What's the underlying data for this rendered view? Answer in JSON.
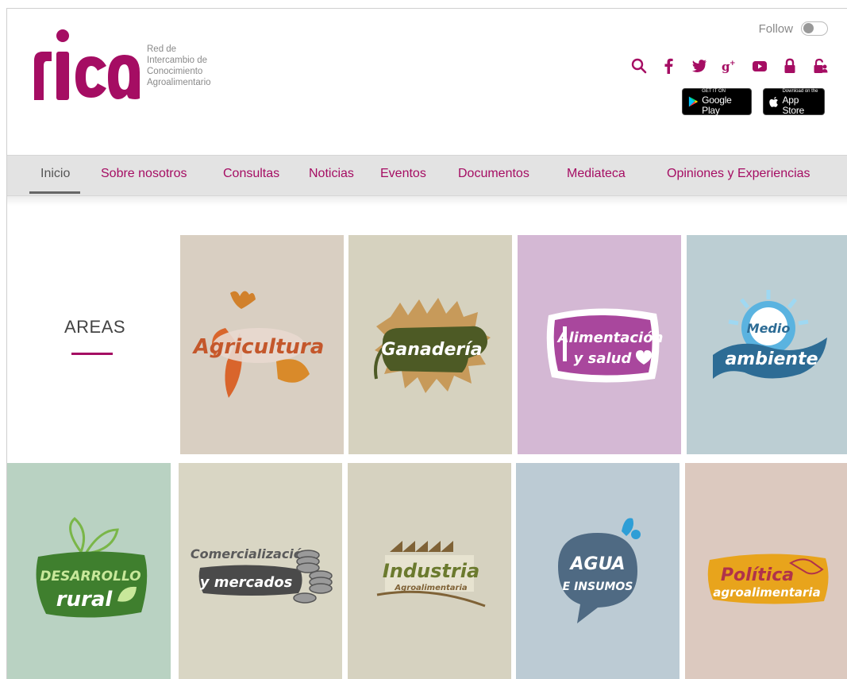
{
  "brand": {
    "logo_text": "rica",
    "tagline": [
      "Red de",
      "Intercambio de",
      "Conocimiento",
      "Agroalimentario"
    ],
    "accent_color": "#a50d63"
  },
  "header": {
    "follow_label": "Follow",
    "follow_enabled": false,
    "social_icons": [
      "search-icon",
      "facebook-icon",
      "twitter-icon",
      "google-plus-icon",
      "youtube-icon",
      "lock-icon",
      "user-lock-icon"
    ],
    "stores": {
      "google_play": {
        "small": "GET IT ON",
        "big": "Google Play"
      },
      "app_store": {
        "small": "Download on the",
        "big": "App Store"
      }
    }
  },
  "nav": {
    "items": [
      {
        "label": "Inicio",
        "active": true
      },
      {
        "label": "Sobre nosotros"
      },
      {
        "label": "Consultas"
      },
      {
        "label": "Noticias"
      },
      {
        "label": "Eventos"
      },
      {
        "label": "Documentos"
      },
      {
        "label": "Mediateca"
      },
      {
        "label": "Opiniones y Experiencias"
      }
    ]
  },
  "areas": {
    "title": "AREAS",
    "tiles": [
      {
        "line1": "Agricultura",
        "bg": "#d9cfc2"
      },
      {
        "line1": "Ganadería",
        "bg": "#d6d2bf"
      },
      {
        "line1": "Alimentación",
        "line2": "y salud",
        "bg": "#d4b8d4"
      },
      {
        "line1": "Medio",
        "line2": "ambiente",
        "bg": "#bcced3"
      },
      {
        "line1": "DESARROLLO",
        "line2": "rural",
        "bg": "#b9d2c2"
      },
      {
        "line1": "Comercialización",
        "line2": "y mercados",
        "bg": "#d9d6c4"
      },
      {
        "line1": "Industria",
        "line2": "Agroalimentaria",
        "bg": "#d6d2c0"
      },
      {
        "line1": "AGUA",
        "line2": "E INSUMOS",
        "bg": "#bccbd4"
      },
      {
        "line1": "Política",
        "line2": "agroalimentaria",
        "bg": "#dcc9bf"
      }
    ]
  }
}
